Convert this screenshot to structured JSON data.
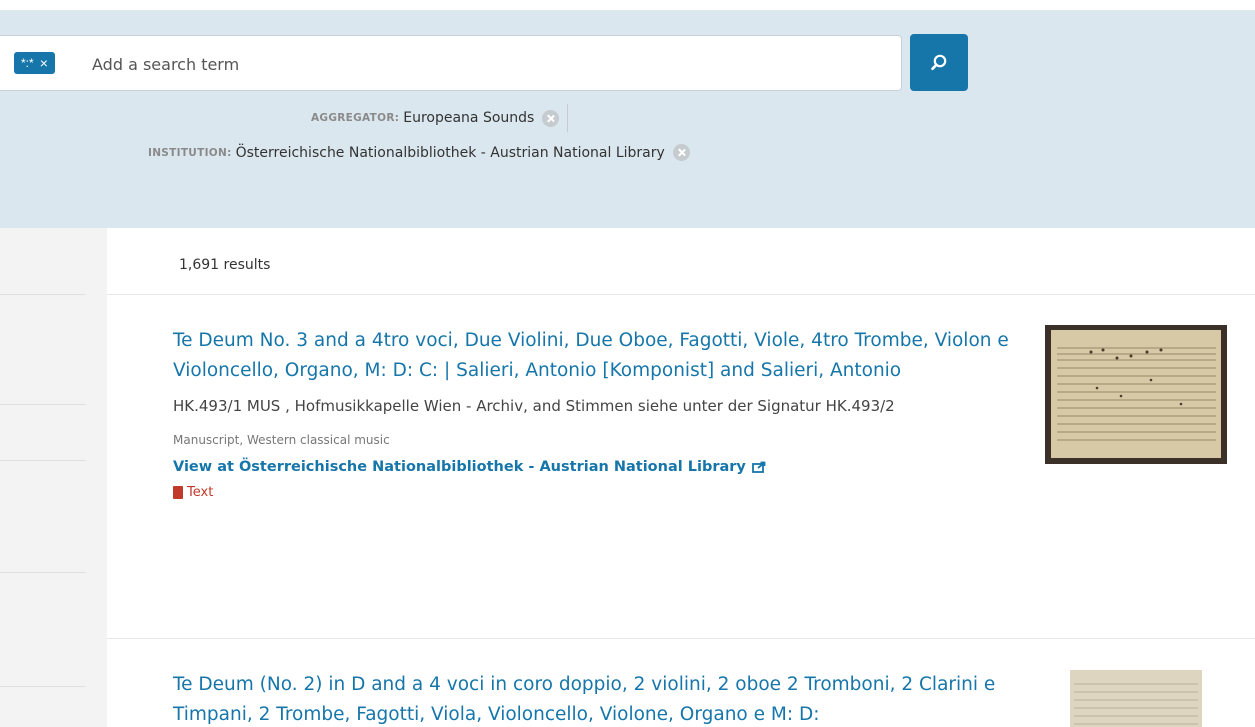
{
  "search": {
    "query_chip": "*:*",
    "chip_close": "×",
    "placeholder": "Add a search term"
  },
  "filters": [
    {
      "key": "AGGREGATOR:",
      "value": "Europeana Sounds"
    },
    {
      "key": "INSTITUTION:",
      "value": "Österreichische Nationalbibliothek - Austrian National Library"
    }
  ],
  "results": {
    "count_label": "1,691 results",
    "items": [
      {
        "title": "Te Deum No. 3 and a 4tro voci, Due Violini, Due Oboe, Fagotti, Viole, 4tro Trombe, Violon e Violoncello, Organo, M: D: C: | Salieri, Antonio [Komponist] and Salieri, Antonio",
        "description": "HK.493/1 MUS , Hofmusikkapelle Wien - Archiv, and Stimmen siehe unter der Signatur HK.493/2",
        "meta": "Manuscript,  Western classical music",
        "link": "View at Österreichische Nationalbibliothek - Austrian National Library",
        "type": "Text"
      },
      {
        "title": "Te Deum (No. 2) in D and a 4 voci in coro doppio, 2 violini, 2 oboe 2 Tromboni, 2 Clarini e Timpani, 2 Trombe, Fagotti, Viola, Violoncello, Violone, Organo e M: D:"
      }
    ]
  },
  "colors": {
    "accent": "#1676aa",
    "band": "#dbe7ee",
    "type_red": "#c0392b"
  },
  "icons": [
    "search-icon",
    "close-icon",
    "remove-filter-icon",
    "external-link-icon",
    "book-icon"
  ]
}
